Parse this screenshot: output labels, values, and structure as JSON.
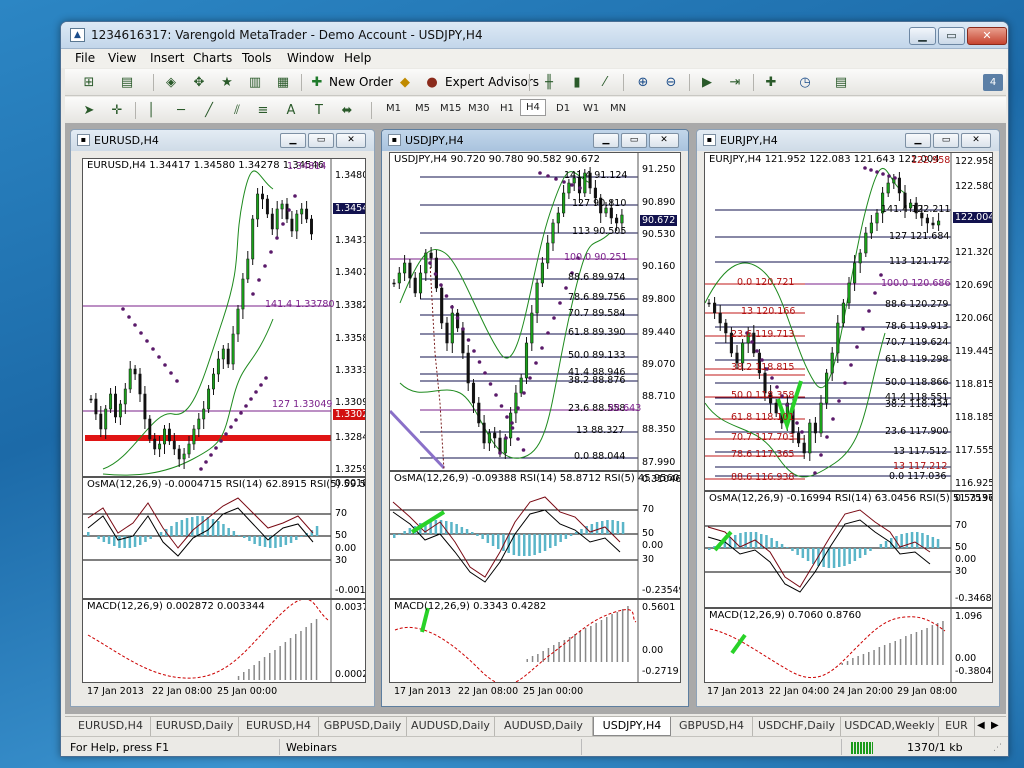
{
  "window": {
    "title": "1234616317: Varengold MetaTrader - Demo Account - USDJPY,H4",
    "min": "▁",
    "max": "▭",
    "close": "✕"
  },
  "menu": [
    "File",
    "View",
    "Insert",
    "Charts",
    "Tools",
    "Window",
    "Help"
  ],
  "toolbar": {
    "new_order": "New Order",
    "expert_advisors": "Expert Advisors",
    "notif_count": "4"
  },
  "timeframes": [
    "M1",
    "M5",
    "M15",
    "M30",
    "H1",
    "H4",
    "D1",
    "W1",
    "MN"
  ],
  "charts": [
    {
      "title": "EURUSD,H4",
      "main_label": "EURUSD,H4  1.34417 1.34580 1.34278 1.34546",
      "price_axis": [
        "1.34805",
        "1.34546",
        "1.34315",
        "1.34070",
        "1.33825",
        "1.33580",
        "1.33335",
        "1.33090",
        "1.33025",
        "1.32845",
        "1.32599"
      ],
      "levels": [
        {
          "text": "141.4  1.33780"
        },
        {
          "text": "127  1.33049"
        },
        {
          "text": "1.34814"
        }
      ],
      "osma_label": "OsMA(12,26,9) -0.0004715  RSI(14) 62.8915  RSI(5) 59.5",
      "osma_axis": [
        "0.001831",
        "70",
        "50",
        "0.00",
        "30",
        "-0.001150"
      ],
      "macd_label": "MACD(12,26,9) 0.002872 0.003344",
      "macd_axis": [
        "0.003798",
        "0.000218"
      ],
      "dates": [
        "17 Jan 2013",
        "22 Jan 08:00",
        "25 Jan 00:00"
      ]
    },
    {
      "title": "USDJPY,H4",
      "main_label": "USDJPY,H4  90.720 90.780 90.582 90.672",
      "price_axis": [
        "91.250",
        "90.890",
        "90.672",
        "90.530",
        "90.160",
        "89.800",
        "89.440",
        "89.070",
        "88.710",
        "88.350",
        "87.990"
      ],
      "levels": [
        {
          "text": "141.4  91.124"
        },
        {
          "text": "127  90.810"
        },
        {
          "text": "113  90.505"
        },
        {
          "text": "100.0  90.251"
        },
        {
          "text": "88.6  89.974"
        },
        {
          "text": "78.6  89.756"
        },
        {
          "text": "70.7  89.584"
        },
        {
          "text": "61.8  89.390"
        },
        {
          "text": "50.0  89.133"
        },
        {
          "text": "41.4  88.946"
        },
        {
          "text": "38.2  88.876"
        },
        {
          "text": "23.6  88.558"
        },
        {
          "text": "13  88.327"
        },
        {
          "text": "0.0  88.044"
        },
        {
          "text": "88.643"
        }
      ],
      "osma_label": "OsMA(12,26,9) -0.09388  RSI(14) 58.8712  RSI(5) 45.9560",
      "osma_axis": [
        "0.31046",
        "70",
        "50",
        "0.00",
        "30",
        "-0.23549"
      ],
      "macd_label": "MACD(12,26,9) 0.3343 0.4282",
      "macd_axis": [
        "0.5601",
        "0.00",
        "-0.2719"
      ],
      "dates": [
        "17 Jan 2013",
        "22 Jan 08:00",
        "25 Jan 00:00"
      ]
    },
    {
      "title": "EURJPY,H4",
      "main_label": "EURJPY,H4  121.952 122.083 121.643 122.004",
      "price_axis": [
        "122.958",
        "122.580",
        "122.004",
        "121.320",
        "120.690",
        "120.060",
        "119.445",
        "118.815",
        "118.185",
        "117.555",
        "116.925"
      ],
      "levels": [
        {
          "text": "141.4  122.211"
        },
        {
          "text": "127  121.684"
        },
        {
          "text": "113  121.172"
        },
        {
          "text": "100.0  120.686"
        },
        {
          "text": "88.6  120.279"
        },
        {
          "text": "78.6  119.913"
        },
        {
          "text": "70.7  119.624"
        },
        {
          "text": "61.8  119.298"
        },
        {
          "text": "50.0  118.866"
        },
        {
          "text": "41.4  118.551"
        },
        {
          "text": "38.2  118.434"
        },
        {
          "text": "23.6  117.900"
        },
        {
          "text": "13  117.512"
        },
        {
          "text": "13  117.212"
        },
        {
          "text": "0.0  117.036"
        },
        {
          "text": "0.0  120.721"
        },
        {
          "text": "13  120.166"
        },
        {
          "text": "23.6  119.713"
        },
        {
          "text": "38.2  118.815"
        },
        {
          "text": "50.0  118.358"
        },
        {
          "text": "61.8  118.101"
        },
        {
          "text": "70.7  117.703"
        },
        {
          "text": "78.6  117.365"
        },
        {
          "text": "88.6  116.938"
        },
        {
          "text": "122.958"
        }
      ],
      "osma_label": "OsMA(12,26,9) -0.16994  RSI(14) 63.0456  RSI(5) 51.7537",
      "osma_axis": [
        "0.53196",
        "70",
        "50",
        "0.00",
        "30",
        "-0.3468"
      ],
      "macd_label": "MACD(12,26,9) 0.7060 0.8760",
      "macd_axis": [
        "1.096",
        "0.00",
        "-0.3804"
      ],
      "dates": [
        "17 Jan 2013",
        "22 Jan 04:00",
        "24 Jan 20:00",
        "29 Jan 08:00"
      ]
    }
  ],
  "symbol_tabs": [
    "EURUSD,H4",
    "EURUSD,Daily",
    "EURUSD,H4",
    "GBPUSD,Daily",
    "AUDUSD,Daily",
    "AUDUSD,Daily",
    "USDJPY,H4",
    "GBPUSD,H4",
    "USDCHF,Daily",
    "USDCAD,Weekly",
    "EUR"
  ],
  "status": {
    "help": "For Help, press F1",
    "webinars": "Webinars",
    "traffic": "1370/1 kb"
  }
}
